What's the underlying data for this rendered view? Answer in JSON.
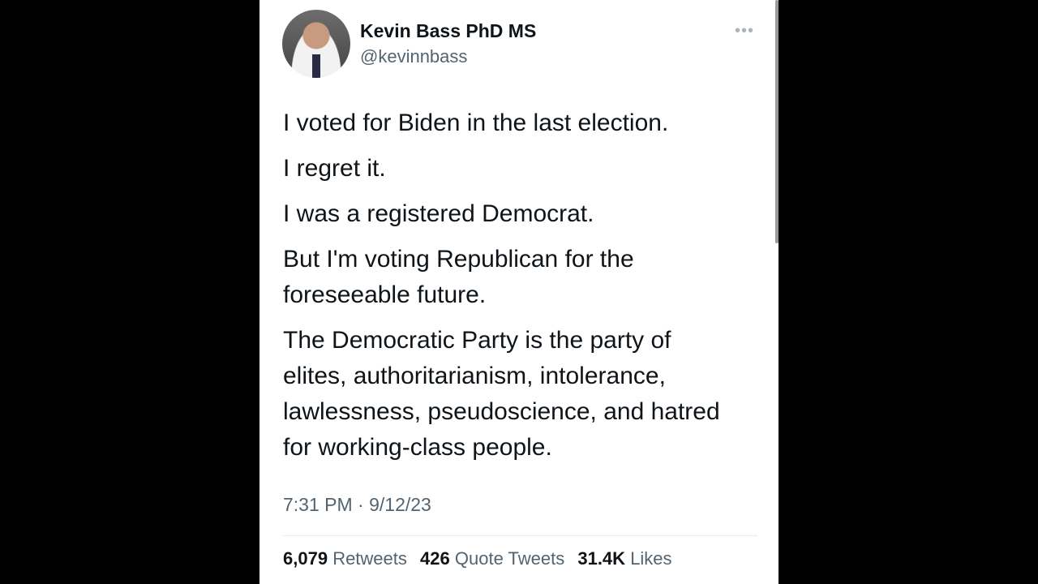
{
  "tweet": {
    "author": {
      "display_name": "Kevin Bass PhD MS",
      "handle": "@kevinnbass"
    },
    "more_icon": "more-horizontal-icon",
    "paragraphs": [
      "I voted for Biden in the last election.",
      "I regret it.",
      "I was a registered Democrat.",
      "But I'm voting Republican for the foreseeable future.",
      "The Democratic Party is the party of elites, authoritarianism, intolerance, lawlessness, pseudoscience, and hatred for working-class people."
    ],
    "timestamp": "7:31 PM · 9/12/23",
    "stats": {
      "retweets_count": "6,079",
      "retweets_label": "Retweets",
      "quotes_count": "426",
      "quotes_label": "Quote Tweets",
      "likes_count": "31.4K",
      "likes_label": "Likes"
    }
  }
}
